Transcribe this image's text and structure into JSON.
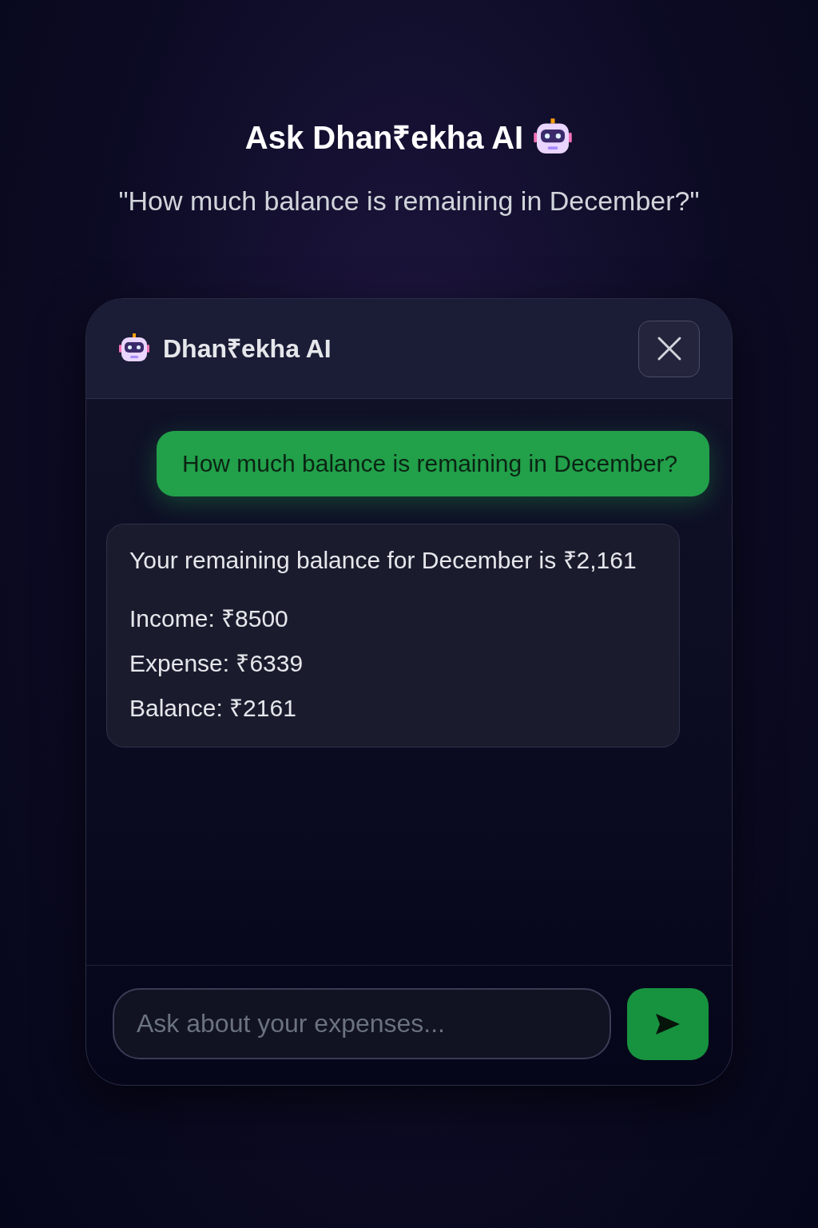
{
  "page": {
    "title": "Ask Dhan₹ekha AI",
    "subtitle": "\"How much balance is remaining in December?\""
  },
  "chat": {
    "title": "Dhan₹ekha AI",
    "messages": [
      {
        "kind": "user",
        "text": "How much balance is remaining in December?"
      },
      {
        "kind": "bot",
        "text": "Your remaining balance for December is ₹2,161",
        "lines": [
          "Income: ₹8500",
          "Expense: ₹6339",
          "Balance: ₹2161"
        ]
      }
    ],
    "input": {
      "placeholder": "Ask about your expenses..."
    }
  }
}
